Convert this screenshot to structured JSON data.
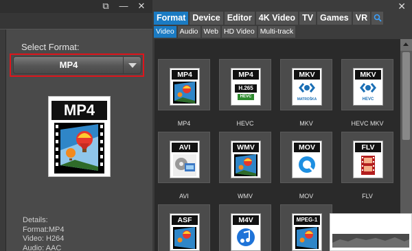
{
  "window": {
    "left_controls": [
      "restore",
      "minimize",
      "close"
    ],
    "right_controls": [
      "close"
    ]
  },
  "left_panel": {
    "select_label": "Select Format:",
    "selected_format": "MP4",
    "big_icon_label": "MP4",
    "details": [
      "Details:",
      "Format:MP4",
      "Video: H264",
      "Audio: AAC"
    ]
  },
  "tabs": {
    "main": [
      "Format",
      "Device",
      "Editor",
      "4K Video",
      "TV",
      "Games",
      "VR"
    ],
    "active_main": "Format",
    "sub": [
      "Video",
      "Audio",
      "Web",
      "HD Video",
      "Multi-track"
    ],
    "active_sub": "Video"
  },
  "formats": [
    {
      "icon_label": "MP4",
      "name": "MP4",
      "art": "video"
    },
    {
      "icon_label": "MP4",
      "name": "HEVC",
      "art": "hevc",
      "sub_text": "H.265",
      "sub_badge": "HEVC"
    },
    {
      "icon_label": "MKV",
      "name": "MKV",
      "art": "matroska",
      "sub_text": "MATROŠKA"
    },
    {
      "icon_label": "MKV",
      "name": "HEVC MKV",
      "art": "matroska-hevc",
      "sub_text": "HEVC"
    },
    {
      "icon_label": "AVI",
      "name": "AVI",
      "art": "avi"
    },
    {
      "icon_label": "WMV",
      "name": "WMV",
      "art": "wmv"
    },
    {
      "icon_label": "MOV",
      "name": "MOV",
      "art": "mov"
    },
    {
      "icon_label": "FLV",
      "name": "FLV",
      "art": "flv"
    },
    {
      "icon_label": "ASF",
      "name": "",
      "art": "asf"
    },
    {
      "icon_label": "M4V",
      "name": "",
      "art": "m4v"
    },
    {
      "icon_label": "MPEG-1",
      "name": "",
      "art": "mpeg"
    }
  ],
  "colors": {
    "accent_tab": "#1b7bc3",
    "highlight_red": "#e0141b"
  }
}
